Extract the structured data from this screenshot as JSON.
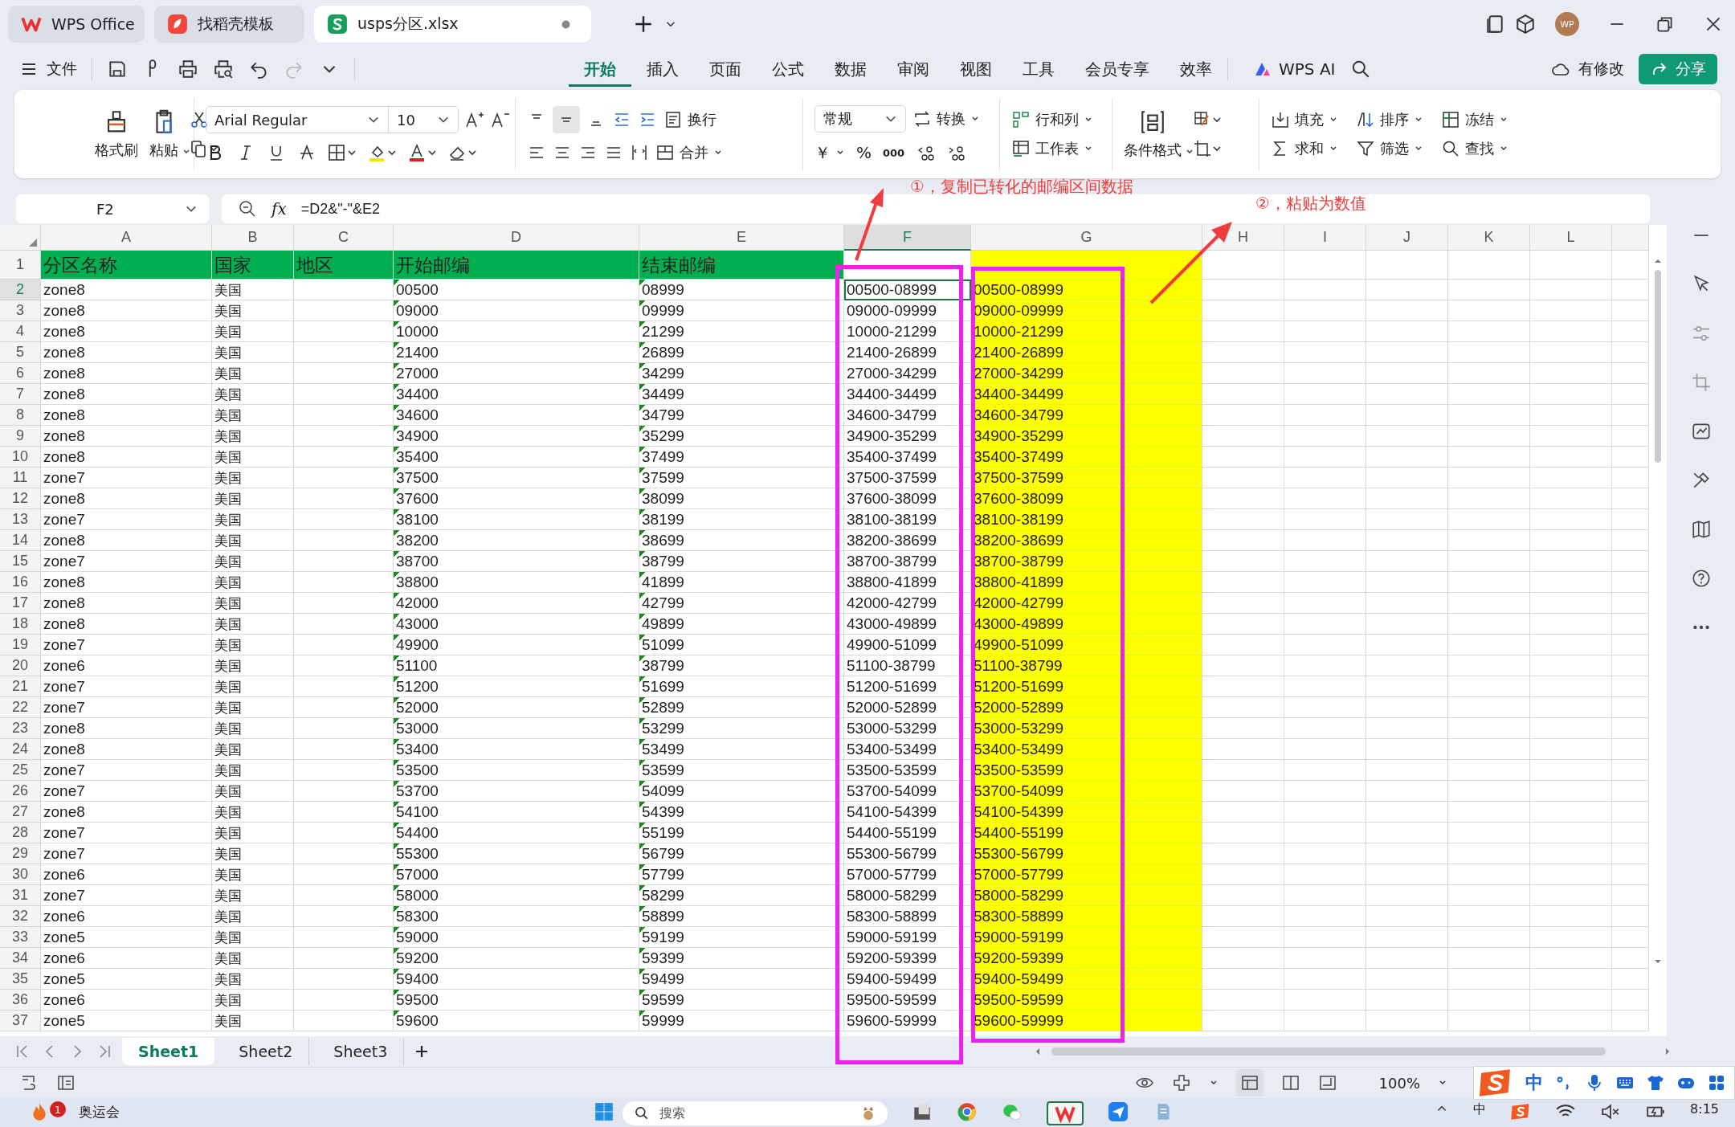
{
  "title_tabs": [
    {
      "label": "WPS Office",
      "kind": "wps",
      "selected": false
    },
    {
      "label": "找稻壳模板",
      "kind": "template",
      "selected": false
    },
    {
      "label": "usps分区.xlsx",
      "kind": "sheet",
      "selected": true
    }
  ],
  "avatar": "WP",
  "menu": {
    "file": "文件",
    "tabs": [
      {
        "label": "开始",
        "selected": true
      },
      {
        "label": "插入",
        "selected": false
      },
      {
        "label": "页面",
        "selected": false
      },
      {
        "label": "公式",
        "selected": false
      },
      {
        "label": "数据",
        "selected": false
      },
      {
        "label": "审阅",
        "selected": false
      },
      {
        "label": "视图",
        "selected": false
      },
      {
        "label": "工具",
        "selected": false
      },
      {
        "label": "会员专享",
        "selected": false
      },
      {
        "label": "效率",
        "selected": false
      }
    ],
    "ai": "WPS AI",
    "status": "有修改",
    "share": "分享"
  },
  "ribbon": {
    "format_painter": "格式刷",
    "paste": "粘贴",
    "font": "Arial Regular",
    "size": "10",
    "wrap": "换行",
    "merge": "合并",
    "number_format": "常规",
    "convert": "转换",
    "currency": "￥",
    "percent": "%",
    "thousands": "000",
    "rows_cols": "行和列",
    "worksheet": "工作表",
    "conditional": "条件格式",
    "fill": "填充",
    "sort": "排序",
    "freeze": "冻结",
    "sum": "求和",
    "filter": "筛选",
    "find": "查找"
  },
  "formula_bar": {
    "cell": "F2",
    "fx": "fx",
    "formula": "=D2&\"-\"&E2"
  },
  "columns": [
    {
      "label": "A",
      "selected": false
    },
    {
      "label": "B",
      "selected": false
    },
    {
      "label": "C",
      "selected": false
    },
    {
      "label": "D",
      "selected": false
    },
    {
      "label": "E",
      "selected": false
    },
    {
      "label": "F",
      "selected": true
    },
    {
      "label": "G",
      "selected": false
    },
    {
      "label": "H",
      "selected": false
    },
    {
      "label": "I",
      "selected": false
    },
    {
      "label": "J",
      "selected": false
    },
    {
      "label": "K",
      "selected": false
    },
    {
      "label": "L",
      "selected": false
    }
  ],
  "header_row": {
    "number": "1",
    "cells": [
      "分区名称",
      "国家",
      "地区",
      "开始邮编",
      "结束邮编"
    ]
  },
  "rows": [
    {
      "number": "2",
      "selected": true,
      "zone": "zone8",
      "country": "美国",
      "start": "00500",
      "end": "08999",
      "range": "00500-08999",
      "pasted": "00500-08999"
    },
    {
      "number": "3",
      "selected": false,
      "zone": "zone8",
      "country": "美国",
      "start": "09000",
      "end": "09999",
      "range": "09000-09999",
      "pasted": "09000-09999"
    },
    {
      "number": "4",
      "selected": false,
      "zone": "zone8",
      "country": "美国",
      "start": "10000",
      "end": "21299",
      "range": "10000-21299",
      "pasted": "10000-21299"
    },
    {
      "number": "5",
      "selected": false,
      "zone": "zone8",
      "country": "美国",
      "start": "21400",
      "end": "26899",
      "range": "21400-26899",
      "pasted": "21400-26899"
    },
    {
      "number": "6",
      "selected": false,
      "zone": "zone8",
      "country": "美国",
      "start": "27000",
      "end": "34299",
      "range": "27000-34299",
      "pasted": "27000-34299"
    },
    {
      "number": "7",
      "selected": false,
      "zone": "zone8",
      "country": "美国",
      "start": "34400",
      "end": "34499",
      "range": "34400-34499",
      "pasted": "34400-34499"
    },
    {
      "number": "8",
      "selected": false,
      "zone": "zone8",
      "country": "美国",
      "start": "34600",
      "end": "34799",
      "range": "34600-34799",
      "pasted": "34600-34799"
    },
    {
      "number": "9",
      "selected": false,
      "zone": "zone8",
      "country": "美国",
      "start": "34900",
      "end": "35299",
      "range": "34900-35299",
      "pasted": "34900-35299"
    },
    {
      "number": "10",
      "selected": false,
      "zone": "zone8",
      "country": "美国",
      "start": "35400",
      "end": "37499",
      "range": "35400-37499",
      "pasted": "35400-37499"
    },
    {
      "number": "11",
      "selected": false,
      "zone": "zone7",
      "country": "美国",
      "start": "37500",
      "end": "37599",
      "range": "37500-37599",
      "pasted": "37500-37599"
    },
    {
      "number": "12",
      "selected": false,
      "zone": "zone8",
      "country": "美国",
      "start": "37600",
      "end": "38099",
      "range": "37600-38099",
      "pasted": "37600-38099"
    },
    {
      "number": "13",
      "selected": false,
      "zone": "zone7",
      "country": "美国",
      "start": "38100",
      "end": "38199",
      "range": "38100-38199",
      "pasted": "38100-38199"
    },
    {
      "number": "14",
      "selected": false,
      "zone": "zone8",
      "country": "美国",
      "start": "38200",
      "end": "38699",
      "range": "38200-38699",
      "pasted": "38200-38699"
    },
    {
      "number": "15",
      "selected": false,
      "zone": "zone7",
      "country": "美国",
      "start": "38700",
      "end": "38799",
      "range": "38700-38799",
      "pasted": "38700-38799"
    },
    {
      "number": "16",
      "selected": false,
      "zone": "zone8",
      "country": "美国",
      "start": "38800",
      "end": "41899",
      "range": "38800-41899",
      "pasted": "38800-41899"
    },
    {
      "number": "17",
      "selected": false,
      "zone": "zone8",
      "country": "美国",
      "start": "42000",
      "end": "42799",
      "range": "42000-42799",
      "pasted": "42000-42799"
    },
    {
      "number": "18",
      "selected": false,
      "zone": "zone8",
      "country": "美国",
      "start": "43000",
      "end": "49899",
      "range": "43000-49899",
      "pasted": "43000-49899"
    },
    {
      "number": "19",
      "selected": false,
      "zone": "zone7",
      "country": "美国",
      "start": "49900",
      "end": "51099",
      "range": "49900-51099",
      "pasted": "49900-51099"
    },
    {
      "number": "20",
      "selected": false,
      "zone": "zone6",
      "country": "美国",
      "start": "51100",
      "end": "38799",
      "range": "51100-38799",
      "pasted": "51100-38799"
    },
    {
      "number": "21",
      "selected": false,
      "zone": "zone7",
      "country": "美国",
      "start": "51200",
      "end": "51699",
      "range": "51200-51699",
      "pasted": "51200-51699"
    },
    {
      "number": "22",
      "selected": false,
      "zone": "zone7",
      "country": "美国",
      "start": "52000",
      "end": "52899",
      "range": "52000-52899",
      "pasted": "52000-52899"
    },
    {
      "number": "23",
      "selected": false,
      "zone": "zone8",
      "country": "美国",
      "start": "53000",
      "end": "53299",
      "range": "53000-53299",
      "pasted": "53000-53299"
    },
    {
      "number": "24",
      "selected": false,
      "zone": "zone8",
      "country": "美国",
      "start": "53400",
      "end": "53499",
      "range": "53400-53499",
      "pasted": "53400-53499"
    },
    {
      "number": "25",
      "selected": false,
      "zone": "zone7",
      "country": "美国",
      "start": "53500",
      "end": "53599",
      "range": "53500-53599",
      "pasted": "53500-53599"
    },
    {
      "number": "26",
      "selected": false,
      "zone": "zone7",
      "country": "美国",
      "start": "53700",
      "end": "54099",
      "range": "53700-54099",
      "pasted": "53700-54099"
    },
    {
      "number": "27",
      "selected": false,
      "zone": "zone8",
      "country": "美国",
      "start": "54100",
      "end": "54399",
      "range": "54100-54399",
      "pasted": "54100-54399"
    },
    {
      "number": "28",
      "selected": false,
      "zone": "zone7",
      "country": "美国",
      "start": "54400",
      "end": "55199",
      "range": "54400-55199",
      "pasted": "54400-55199"
    },
    {
      "number": "29",
      "selected": false,
      "zone": "zone7",
      "country": "美国",
      "start": "55300",
      "end": "56799",
      "range": "55300-56799",
      "pasted": "55300-56799"
    },
    {
      "number": "30",
      "selected": false,
      "zone": "zone6",
      "country": "美国",
      "start": "57000",
      "end": "57799",
      "range": "57000-57799",
      "pasted": "57000-57799"
    },
    {
      "number": "31",
      "selected": false,
      "zone": "zone7",
      "country": "美国",
      "start": "58000",
      "end": "58299",
      "range": "58000-58299",
      "pasted": "58000-58299"
    },
    {
      "number": "32",
      "selected": false,
      "zone": "zone6",
      "country": "美国",
      "start": "58300",
      "end": "58899",
      "range": "58300-58899",
      "pasted": "58300-58899"
    },
    {
      "number": "33",
      "selected": false,
      "zone": "zone5",
      "country": "美国",
      "start": "59000",
      "end": "59199",
      "range": "59000-59199",
      "pasted": "59000-59199"
    },
    {
      "number": "34",
      "selected": false,
      "zone": "zone6",
      "country": "美国",
      "start": "59200",
      "end": "59399",
      "range": "59200-59399",
      "pasted": "59200-59399"
    },
    {
      "number": "35",
      "selected": false,
      "zone": "zone5",
      "country": "美国",
      "start": "59400",
      "end": "59499",
      "range": "59400-59499",
      "pasted": "59400-59499"
    },
    {
      "number": "36",
      "selected": false,
      "zone": "zone6",
      "country": "美国",
      "start": "59500",
      "end": "59599",
      "range": "59500-59599",
      "pasted": "59500-59599"
    },
    {
      "number": "37",
      "selected": false,
      "zone": "zone5",
      "country": "美国",
      "start": "59600",
      "end": "59999",
      "range": "59600-59999",
      "pasted": "59600-59999"
    }
  ],
  "annotations": [
    {
      "text": "①，复制已转化的邮编区间数据"
    },
    {
      "text": "②，粘贴为数值"
    }
  ],
  "sheets": [
    {
      "label": "Sheet1",
      "selected": true
    },
    {
      "label": "Sheet2",
      "selected": false
    },
    {
      "label": "Sheet3",
      "selected": false
    }
  ],
  "status_bar": {
    "zoom": "100%"
  },
  "ime": {
    "lang": "中"
  },
  "taskbar": {
    "badge": "1",
    "news": "奥运会",
    "search": "搜索",
    "ime": "中",
    "time": "8:15"
  }
}
